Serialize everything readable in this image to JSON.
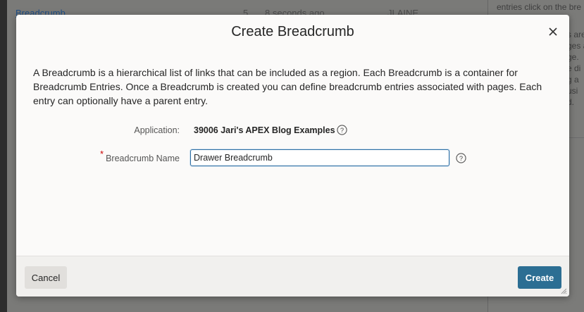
{
  "background": {
    "row": {
      "link": "Breadcrumb",
      "count": "5",
      "time": "8 seconds ago",
      "user": "JLAINE"
    },
    "side_panel": {
      "text": "entries click on the bre",
      "fragments": [
        "s are",
        "ges a",
        "ge.",
        "e di",
        "g a",
        " usi",
        "d."
      ]
    }
  },
  "dialog": {
    "title": "Create Breadcrumb",
    "description": "A Breadcrumb is a hierarchical list of links that can be included as a region. Each Breadcrumb is a container for Breadcrumb Entries. Once a Breadcrumb is created you can define breadcrumb entries associated with pages. Each entry can optionally have a parent entry.",
    "application_label": "Application:",
    "application_value": "39006 Jari's APEX Blog Examples",
    "required_marker": "*",
    "name_label": "Breadcrumb Name",
    "name_value": "Drawer Breadcrumb",
    "cancel_label": "Cancel",
    "create_label": "Create",
    "help_glyph": "?"
  },
  "colors": {
    "primary_button": "#2c6e93",
    "input_focus": "#2f6fa3",
    "required": "#cc0000"
  },
  "icons": [
    "close-icon",
    "help-icon",
    "resize-grip-icon"
  ]
}
